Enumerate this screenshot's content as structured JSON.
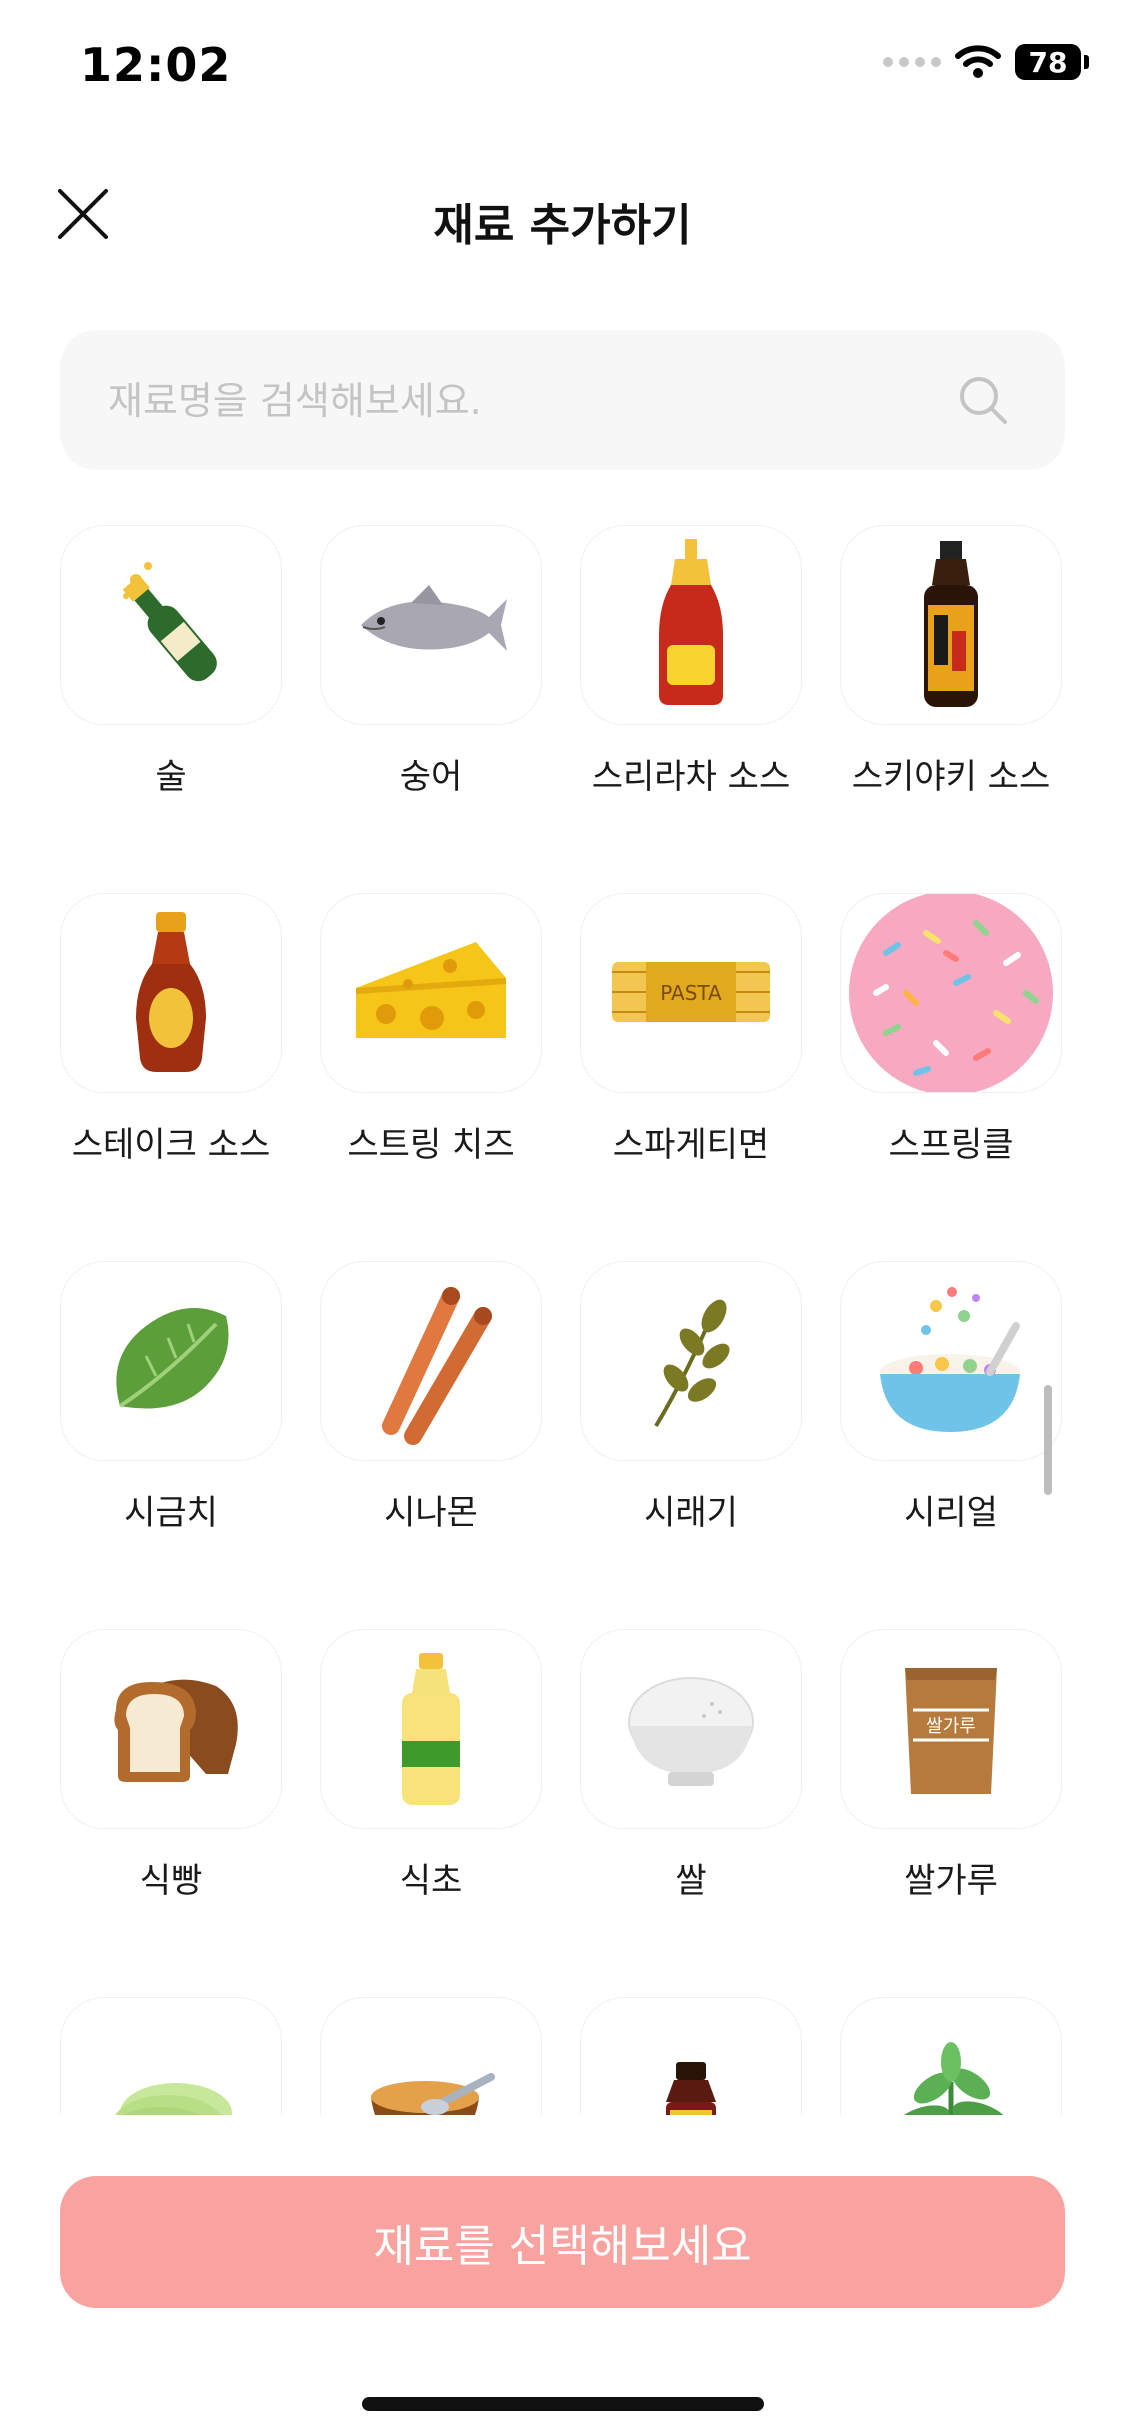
{
  "status_bar": {
    "time": "12:02",
    "battery": "78"
  },
  "header": {
    "title": "재료 추가하기",
    "close_icon": "close-icon"
  },
  "search": {
    "placeholder": "재료명을 검색해보세요.",
    "value": "",
    "icon": "search-icon"
  },
  "ingredients": [
    {
      "label": "술",
      "icon": "champagne-bottle-icon"
    },
    {
      "label": "숭어",
      "icon": "fish-icon"
    },
    {
      "label": "스리라차 소스",
      "icon": "sriracha-bottle-icon"
    },
    {
      "label": "스키야키 소스",
      "icon": "sukiyaki-sauce-bottle-icon"
    },
    {
      "label": "스테이크 소스",
      "icon": "steak-sauce-bottle-icon"
    },
    {
      "label": "스트링 치즈",
      "icon": "cheese-wedge-icon"
    },
    {
      "label": "스파게티면",
      "icon": "pasta-pack-icon",
      "pack_text": "PASTA"
    },
    {
      "label": "스프링클",
      "icon": "sprinkles-icon"
    },
    {
      "label": "시금치",
      "icon": "spinach-icon"
    },
    {
      "label": "시나몬",
      "icon": "cinnamon-sticks-icon"
    },
    {
      "label": "시래기",
      "icon": "dried-greens-sprig-icon"
    },
    {
      "label": "시리얼",
      "icon": "cereal-bowl-icon"
    },
    {
      "label": "식빵",
      "icon": "bread-loaf-icon"
    },
    {
      "label": "식초",
      "icon": "vinegar-bottle-icon"
    },
    {
      "label": "쌀",
      "icon": "rice-bowl-icon"
    },
    {
      "label": "쌀가루",
      "icon": "rice-flour-bag-icon",
      "bag_text": "쌀가루"
    },
    {
      "label": "",
      "icon": "sliced-cucumber-icon"
    },
    {
      "label": "",
      "icon": "sauce-bowl-spoon-icon"
    },
    {
      "label": "",
      "icon": "tonic-bottle-icon"
    },
    {
      "label": "",
      "icon": "herb-plant-icon"
    }
  ],
  "footer": {
    "select_button_label": "재료를 선택해보세요"
  },
  "colors": {
    "accent": "#f9a3a1",
    "search_bg": "#f7f7f7",
    "tile_border": "#f0f0f0"
  }
}
